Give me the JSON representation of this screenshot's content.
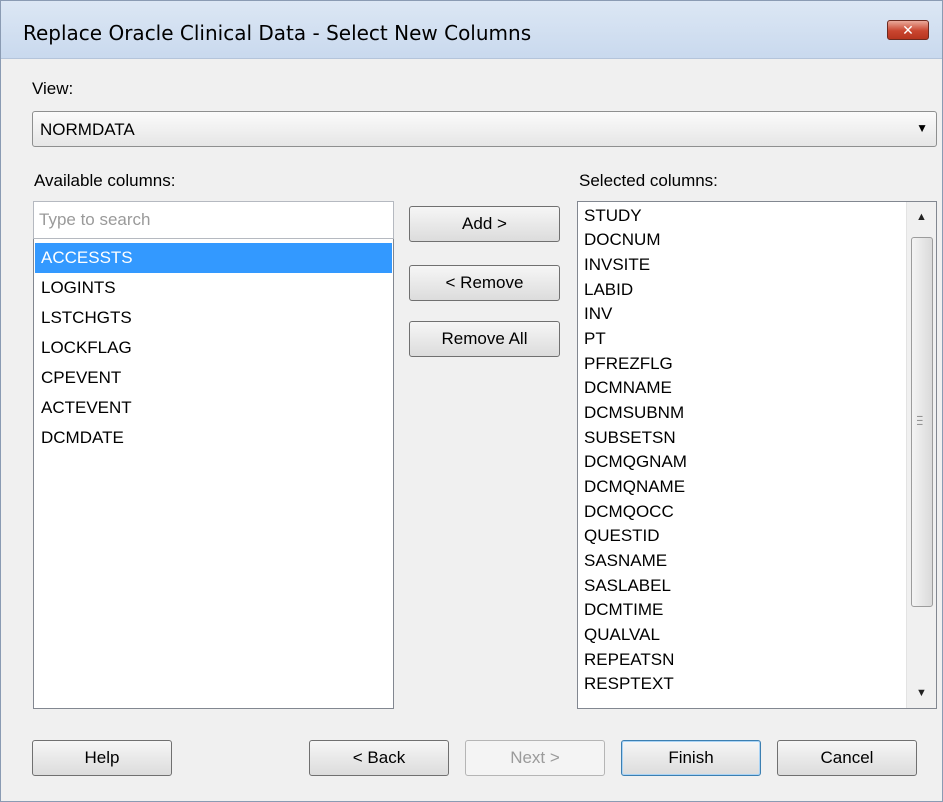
{
  "window": {
    "title": "Replace Oracle Clinical Data - Select New Columns",
    "close_glyph": "✕"
  },
  "view": {
    "label": "View:",
    "selected": "NORMDATA"
  },
  "available": {
    "label": "Available columns:",
    "search_placeholder": "Type to search",
    "items": [
      "ACCESSTS",
      "LOGINTS",
      "LSTCHGTS",
      "LOCKFLAG",
      "CPEVENT",
      "ACTEVENT",
      "DCMDATE"
    ],
    "selected_index": 0
  },
  "actions": {
    "add": "Add >",
    "remove": "< Remove",
    "remove_all": "Remove All"
  },
  "selected": {
    "label": "Selected columns:",
    "items": [
      "STUDY",
      "DOCNUM",
      "INVSITE",
      "LABID",
      "INV",
      "PT",
      "PFREZFLG",
      "DCMNAME",
      "DCMSUBNM",
      "SUBSETSN",
      "DCMQGNAM",
      "DCMQNAME",
      "DCMQOCC",
      "QUESTID",
      "SASNAME",
      "SASLABEL",
      "DCMTIME",
      "QUALVAL",
      "REPEATSN",
      "RESPTEXT"
    ]
  },
  "footer": {
    "help": "Help",
    "back": "< Back",
    "next": "Next >",
    "finish": "Finish",
    "cancel": "Cancel"
  },
  "colors": {
    "selection": "#3399ff",
    "title_bar": "#c9d9ee",
    "close_button": "#c9452f"
  }
}
